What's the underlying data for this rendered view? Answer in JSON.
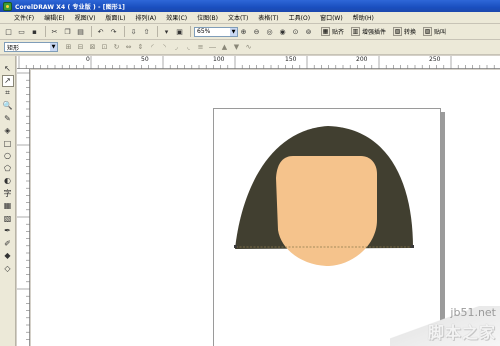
{
  "window": {
    "title": "CorelDRAW X4 ( 专业版 ) - [图形1]"
  },
  "menu": [
    {
      "label": "文件(F)"
    },
    {
      "label": "编辑(E)"
    },
    {
      "label": "视图(V)"
    },
    {
      "label": "版面(L)"
    },
    {
      "label": "排列(A)"
    },
    {
      "label": "效果(C)"
    },
    {
      "label": "位图(B)"
    },
    {
      "label": "文本(T)"
    },
    {
      "label": "表格(T)"
    },
    {
      "label": "工具(O)"
    },
    {
      "label": "窗口(W)"
    },
    {
      "label": "帮助(H)"
    }
  ],
  "toolbar": {
    "zoom_value": "65%",
    "launch_label": "贴齐",
    "enhance_label": "增强插件",
    "convert_label": "转换",
    "paste_label": "贴叫"
  },
  "property_bar": {
    "object_type": "矩形"
  },
  "ruler": {
    "h_labels": [
      "0",
      "50",
      "100",
      "150",
      "200",
      "250"
    ]
  },
  "drawing": {
    "hair_color": "#413f30",
    "face_color": "#f5c38c"
  },
  "watermark": {
    "url": "jb51.net",
    "brand": "脚本之家"
  }
}
